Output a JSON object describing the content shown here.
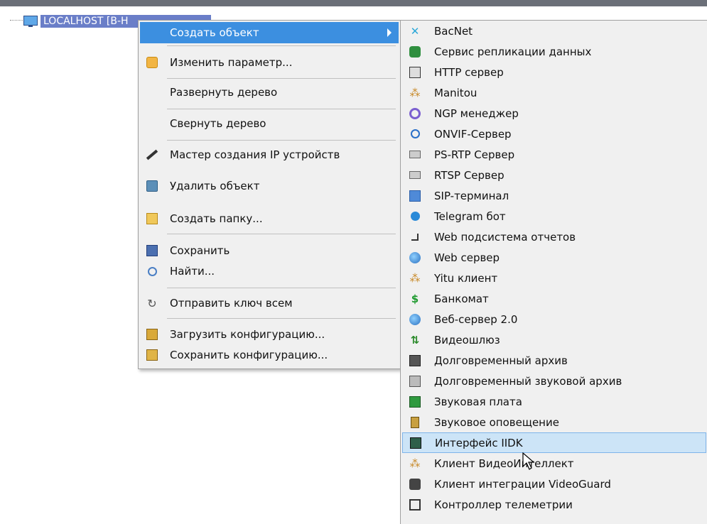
{
  "tree": {
    "node_label": "LOCALHOST [B-H"
  },
  "context_menu": {
    "items": [
      {
        "label": "Создать объект",
        "icon": "none",
        "highlighted": true,
        "has_submenu": true
      },
      {
        "label": "Изменить параметр...",
        "icon": "wrench-icon"
      },
      {
        "label": "Развернуть дерево",
        "icon": "none"
      },
      {
        "label": "Свернуть дерево",
        "icon": "none"
      },
      {
        "label": "Мастер создания IP устройств",
        "icon": "wand-icon"
      },
      {
        "label": "Удалить объект",
        "icon": "delete-icon"
      },
      {
        "label": "Создать папку...",
        "icon": "new-folder-icon"
      },
      {
        "label": "Сохранить",
        "icon": "save-icon"
      },
      {
        "label": "Найти...",
        "icon": "magnifier-icon"
      },
      {
        "label": "Отправить ключ всем",
        "icon": "refresh-icon"
      },
      {
        "label": "Загрузить конфигурацию...",
        "icon": "open-box-icon"
      },
      {
        "label": "Сохранить конфигурацию...",
        "icon": "closed-box-icon"
      }
    ]
  },
  "submenu": {
    "items": [
      {
        "label": "BacNet",
        "icon": "bacnet-icon"
      },
      {
        "label": "Сервис репликации данных",
        "icon": "replication-icon"
      },
      {
        "label": "HTTP сервер",
        "icon": "http-server-icon"
      },
      {
        "label": "Manitou",
        "icon": "network-icon"
      },
      {
        "label": "NGP менеджер",
        "icon": "ngp-icon"
      },
      {
        "label": "ONVIF-Сервер",
        "icon": "ring-icon"
      },
      {
        "label": "PS-RTP Сервер",
        "icon": "server-box-icon"
      },
      {
        "label": "RTSP Сервер",
        "icon": "server-box-icon"
      },
      {
        "label": "SIP-терминал",
        "icon": "sip-terminal-icon"
      },
      {
        "label": "Telegram бот",
        "icon": "telegram-icon"
      },
      {
        "label": "Web подсистема отчетов",
        "icon": "report-icon"
      },
      {
        "label": "Web сервер",
        "icon": "globe-icon"
      },
      {
        "label": "Yitu клиент",
        "icon": "network-icon"
      },
      {
        "label": "Банкомат",
        "icon": "dollar-icon"
      },
      {
        "label": "Веб-сервер 2.0",
        "icon": "globe-icon"
      },
      {
        "label": "Видеошлюз",
        "icon": "gateway-icon"
      },
      {
        "label": "Долговременный архив",
        "icon": "archive-icon"
      },
      {
        "label": "Долговременный звуковой архив",
        "icon": "sound-archive-icon"
      },
      {
        "label": "Звуковая плата",
        "icon": "sound-card-icon"
      },
      {
        "label": "Звуковое оповещение",
        "icon": "speaker-icon"
      },
      {
        "label": "Интерфейс IIDK",
        "icon": "iidk-icon",
        "highlighted": true
      },
      {
        "label": "Клиент ВидеоИнтеллект",
        "icon": "network-icon"
      },
      {
        "label": "Клиент интеграции VideoGuard",
        "icon": "videoguard-icon"
      },
      {
        "label": "Контроллер телеметрии",
        "icon": "telemetry-icon"
      }
    ]
  },
  "colors": {
    "menu_highlight": "#3c8fe0",
    "submenu_highlight": "#cce4f7",
    "tree_selection": "#6a7ec8"
  }
}
